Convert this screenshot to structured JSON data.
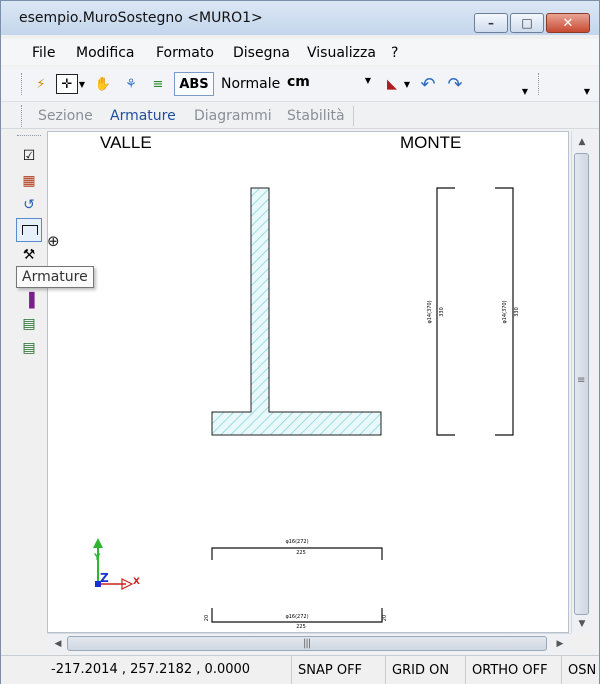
{
  "window": {
    "title": "esempio.MuroSostegno <MURO1>",
    "buttons": {
      "minimize": "–",
      "maximize": "□",
      "close": "✕"
    }
  },
  "menu": [
    "File",
    "Modifica",
    "Formato",
    "Disegna",
    "Visualizza",
    "?"
  ],
  "toolbar": {
    "abs_label": "ABS",
    "mode_label": "Normale",
    "unit_select": "cm",
    "icons": [
      "wand-icon",
      "snap-point-icon",
      "dropdown-icon",
      "hand-icon",
      "zoom-icon",
      "layer-icon",
      "measure-icon",
      "dropdown-icon",
      "undo-icon",
      "redo-icon"
    ]
  },
  "tabs": [
    {
      "label": "Sezione",
      "active": false
    },
    {
      "label": "Armature",
      "active": true
    },
    {
      "label": "Diagrammi",
      "active": false
    },
    {
      "label": "Stabilità",
      "active": false
    }
  ],
  "left_tools": [
    "select-tool-icon",
    "insert-tool-icon",
    "axis-tool-icon",
    "rebar-rectangle-icon",
    "rebar-tool-icon",
    "stirrup-icon",
    "section-rebar-icon",
    "section-rebar-2-icon"
  ],
  "tooltip": "Armature",
  "canvas": {
    "label_left": "VALLE",
    "label_right": "MONTE",
    "rebar_vertical_1": "φ14(370)",
    "rebar_vertical_1_len": "330",
    "rebar_vertical_2": "φ14(370)",
    "rebar_vertical_2_len": "330",
    "rebar_top": "φ16(272)",
    "rebar_top_len": "225",
    "rebar_bottom": "φ16(272)",
    "rebar_bottom_len": "225",
    "rebar_hook_left": "20",
    "rebar_hook_right": "20",
    "axis_labels": {
      "y": "Y",
      "z": "Z",
      "x": "X"
    },
    "colors": {
      "section_fill": "#7fd0d8",
      "axis_y": "#2fb52f",
      "axis_z": "#1c2fd0",
      "axis_x": "#d02020"
    }
  },
  "status": {
    "coordinates": "-217.2014 , 257.2182 , 0.0000",
    "snap": "SNAP OFF",
    "grid": "GRID ON",
    "ortho": "ORTHO OFF",
    "osnap": "OSN"
  }
}
